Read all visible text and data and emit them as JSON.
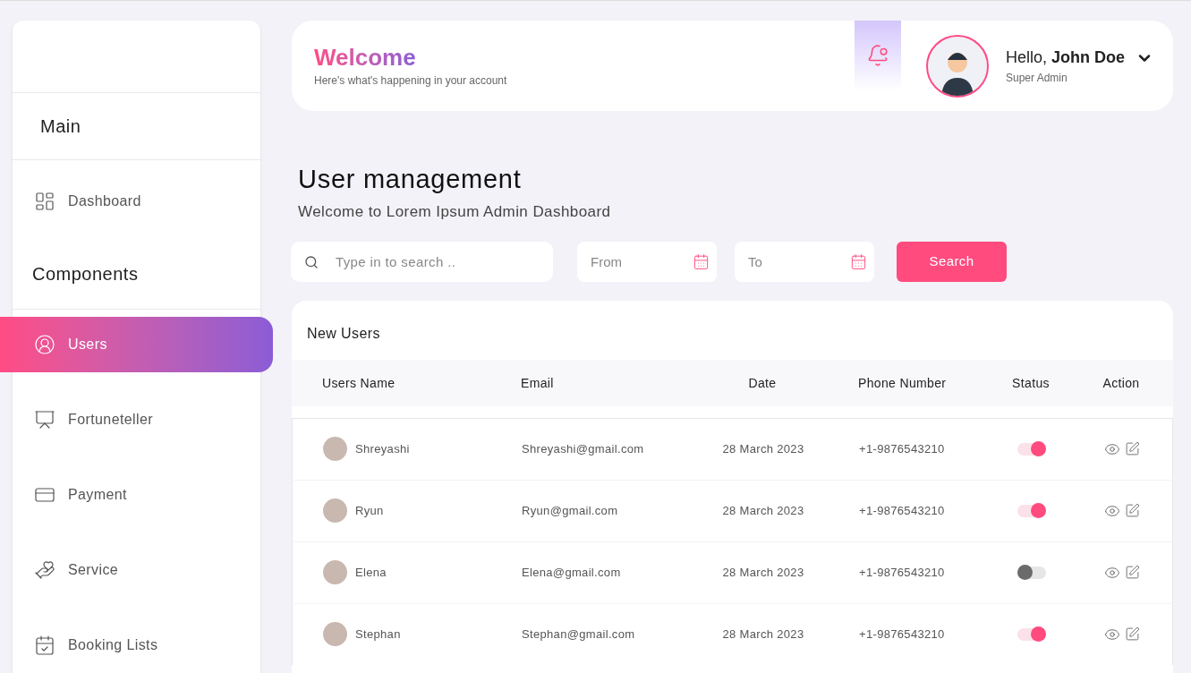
{
  "sidebar": {
    "section_main": "Main",
    "main_items": [
      {
        "label": "Dashboard",
        "kind": "dashboard",
        "selected": false
      }
    ],
    "section_components": "Components",
    "items": [
      {
        "label": "Users",
        "kind": "user",
        "selected": true
      },
      {
        "label": "Fortuneteller",
        "kind": "fortune",
        "selected": false
      },
      {
        "label": "Payment",
        "kind": "payment",
        "selected": false
      },
      {
        "label": "Service",
        "kind": "service",
        "selected": false
      },
      {
        "label": "Booking Lists",
        "kind": "booking",
        "selected": false
      }
    ]
  },
  "header": {
    "title": "Welcome",
    "subtitle": "Here's what's happening in your account",
    "greeting": "Hello, **John Doe**",
    "role": "Super Admin"
  },
  "page": {
    "title": "User management",
    "subtitle": "Welcome to Lorem Ipsum Admin Dashboard"
  },
  "filters": {
    "search_placeholder": "Type in to search ..",
    "from_placeholder": "From",
    "to_placeholder": "To",
    "button": "Search"
  },
  "table": {
    "title": "New Users",
    "columns": [
      "Users Name",
      "Email",
      "Date",
      "Phone Number",
      "Status",
      "Action"
    ],
    "rows": [
      {
        "name": "Shreyashi",
        "email": "Shreyashi@gmail.com",
        "date": "28 March 2023",
        "phone": "+1-9876543210",
        "on": true
      },
      {
        "name": "Ryun",
        "email": "Ryun@gmail.com",
        "date": "28 March 2023",
        "phone": "+1-9876543210",
        "on": true
      },
      {
        "name": "Elena",
        "email": "Elena@gmail.com",
        "date": "28 March 2023",
        "phone": "+1-9876543210",
        "on": false
      },
      {
        "name": "Stephan",
        "email": "Stephan@gmail.com",
        "date": "28 March 2023",
        "phone": "+1-9876543210",
        "on": true
      }
    ]
  }
}
